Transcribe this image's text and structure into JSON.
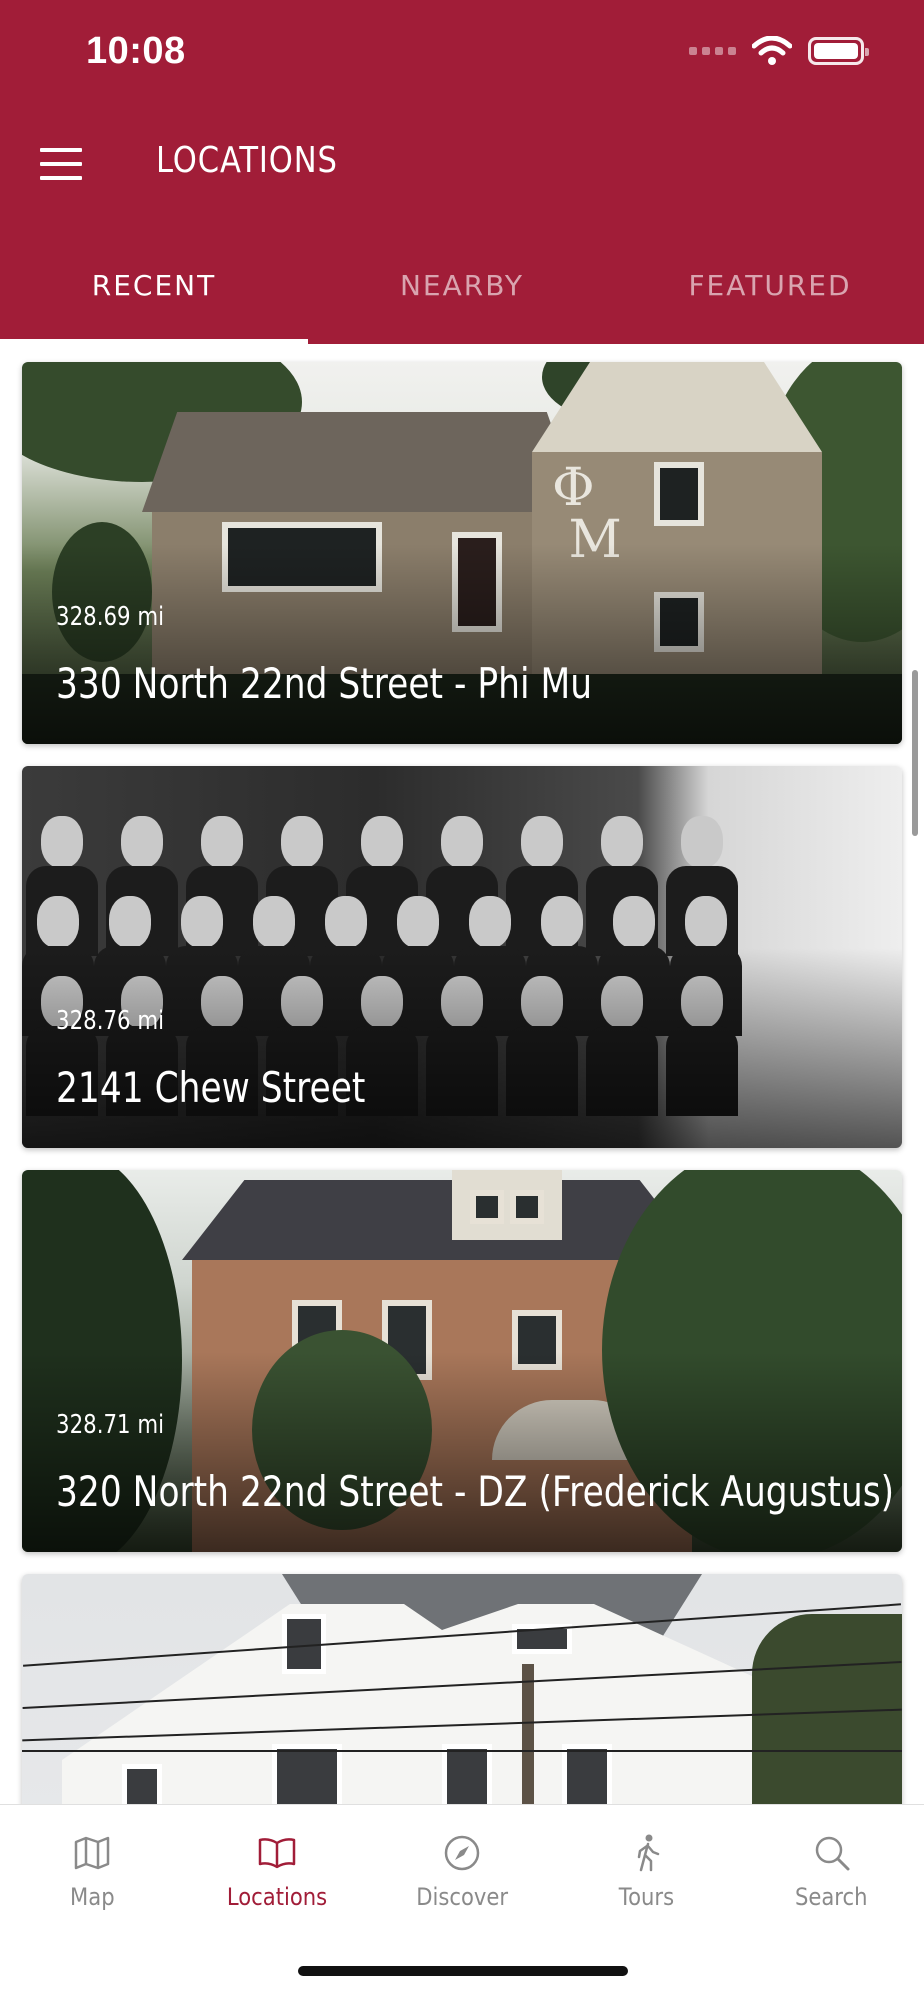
{
  "status_bar": {
    "time": "10:08"
  },
  "header": {
    "title": "LOCATIONS",
    "tabs": [
      {
        "label": "RECENT",
        "active": true
      },
      {
        "label": "NEARBY",
        "active": false
      },
      {
        "label": "FEATURED",
        "active": false
      }
    ]
  },
  "locations": [
    {
      "distance": "328.69 mi",
      "name": "330 North 22nd Street - Phi Mu",
      "image": "stone house with Greek letters"
    },
    {
      "distance": "328.76 mi",
      "name": "2141 Chew Street",
      "image": "black-and-white group photo"
    },
    {
      "distance": "328.71 mi",
      "name": "320 North 22nd Street - DZ (Frederick Augustus)",
      "image": "brick house"
    },
    {
      "distance": "",
      "name": "",
      "image": "white house with power lines"
    }
  ],
  "bottom_nav": {
    "items": [
      {
        "label": "Map",
        "icon": "map-icon",
        "active": false
      },
      {
        "label": "Locations",
        "icon": "book-icon",
        "active": true
      },
      {
        "label": "Discover",
        "icon": "compass-icon",
        "active": false
      },
      {
        "label": "Tours",
        "icon": "walking-icon",
        "active": false
      },
      {
        "label": "Search",
        "icon": "search-icon",
        "active": false
      }
    ]
  },
  "colors": {
    "brand": "#A11D38",
    "inactive": "#8a8a8a"
  }
}
